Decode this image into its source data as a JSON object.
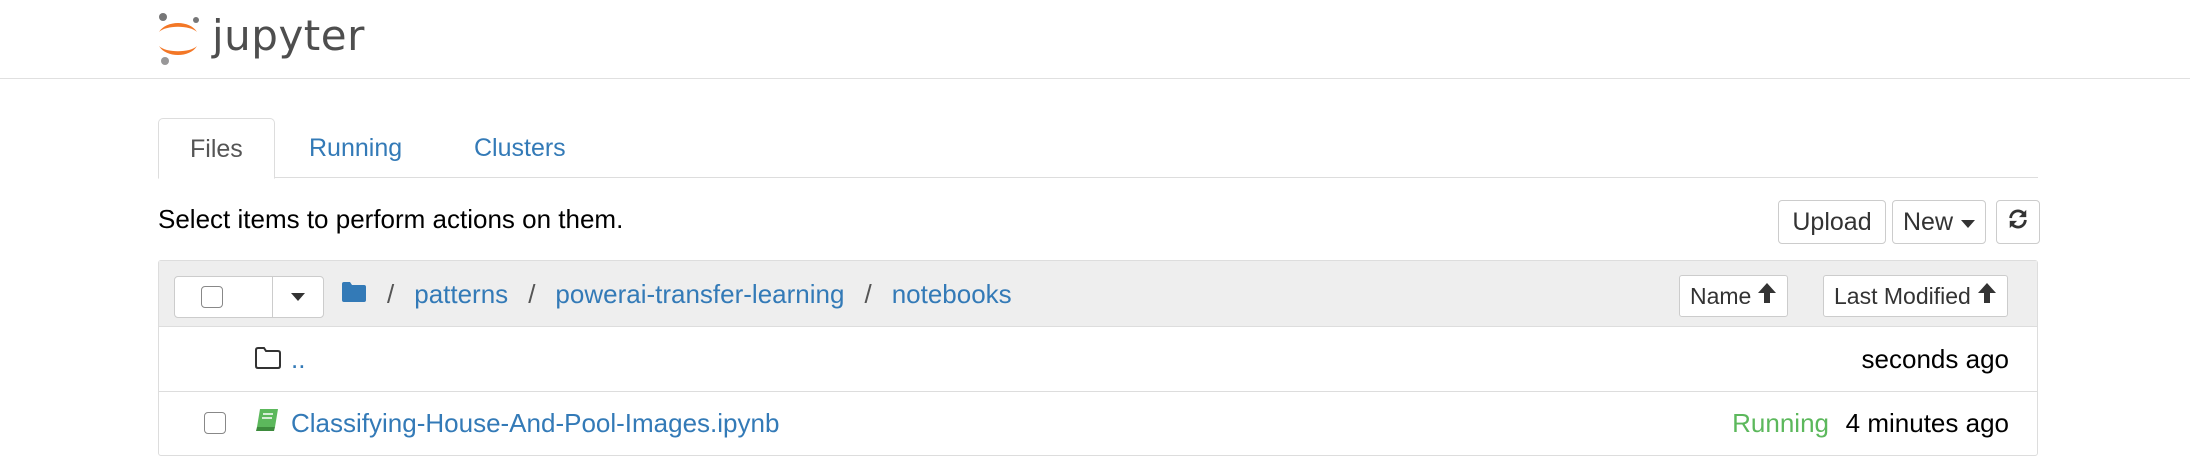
{
  "header": {
    "logo_text": "jupyter"
  },
  "tabs": [
    {
      "label": "Files",
      "active": true
    },
    {
      "label": "Running",
      "active": false
    },
    {
      "label": "Clusters",
      "active": false
    }
  ],
  "toolbar": {
    "instructions": "Select items to perform actions on them.",
    "upload_label": "Upload",
    "new_label": "New",
    "refresh_icon": "refresh-icon"
  },
  "list": {
    "breadcrumb": {
      "root_icon": "folder-icon",
      "items": [
        "patterns",
        "powerai-transfer-learning",
        "notebooks"
      ],
      "separator": "/"
    },
    "sort": {
      "name_label": "Name",
      "modified_label": "Last Modified"
    },
    "rows": [
      {
        "icon": "folder-outline-icon",
        "name": "..",
        "status": "",
        "modified": "seconds ago"
      },
      {
        "icon": "notebook-icon",
        "name": "Classifying-House-And-Pool-Images.ipynb",
        "status": "Running",
        "modified": "4 minutes ago"
      }
    ]
  },
  "colors": {
    "link": "#337ab7",
    "running": "#5cb85c",
    "logo_orange": "#f37726"
  }
}
